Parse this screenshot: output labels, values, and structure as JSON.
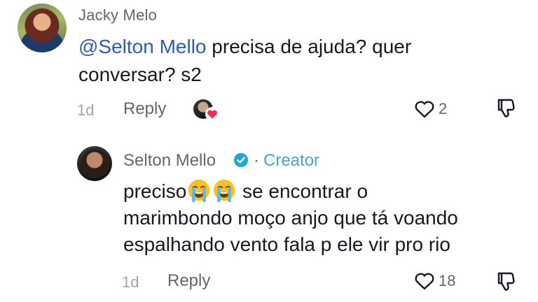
{
  "comment": {
    "author": "Jacky Melo",
    "mention": "@Selton Mello",
    "text_line1": " precisa de ajuda? quer",
    "text_line2": "conversar? s2",
    "time": "1d",
    "reply_label": "Reply",
    "like_count": "2"
  },
  "reply": {
    "author": "Selton Mello",
    "badge_separator": "·",
    "role": "Creator",
    "text_start": "preciso",
    "text_after_emoji": " se encontrar o",
    "text_line2": "marimbondo moço anjo que tá voando",
    "text_line3": "espalhando vento fala p ele vir pro rio",
    "time": "1d",
    "reply_label": "Reply",
    "like_count": "18"
  },
  "icons": {
    "like": "heart-outline-icon",
    "dislike": "thumbs-down-outline-icon",
    "verified": "verified-badge-icon",
    "emoji": "crying-face-emoji",
    "creator_like": "red-heart-icon"
  },
  "colors": {
    "mention": "#2b5db8",
    "creator": "#4aa3c8",
    "verified": "#20a7d8",
    "heart": "#fe2c55"
  }
}
